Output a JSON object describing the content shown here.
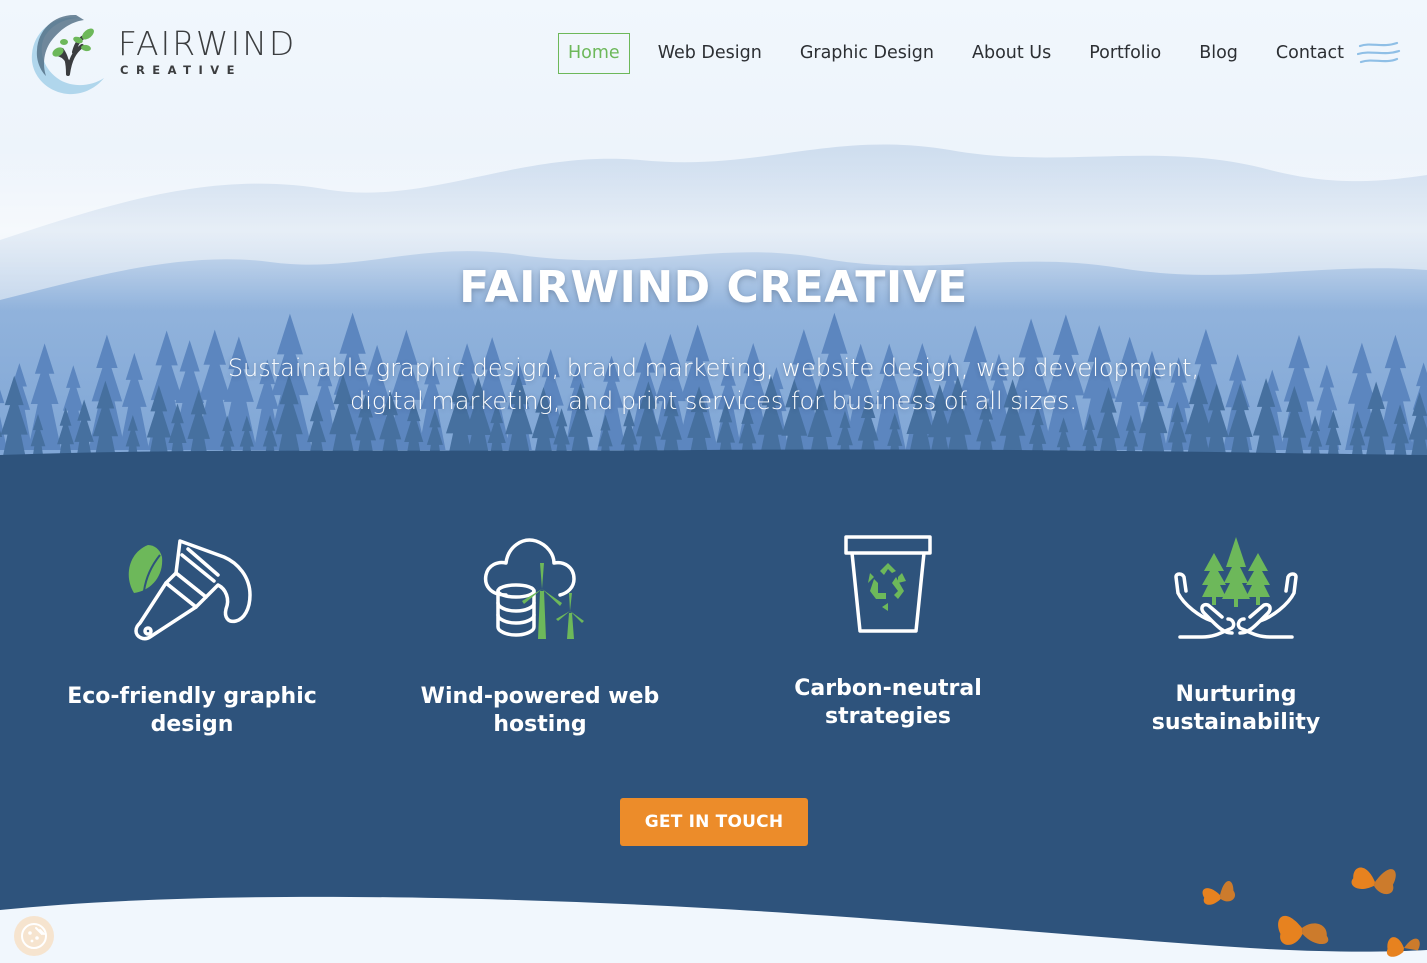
{
  "brand": {
    "name": "FAIRWIND",
    "tagline": "CREATIVE"
  },
  "nav": {
    "items": [
      {
        "label": "Home",
        "active": true
      },
      {
        "label": "Web Design",
        "active": false
      },
      {
        "label": "Graphic Design",
        "active": false
      },
      {
        "label": "About Us",
        "active": false
      },
      {
        "label": "Portfolio",
        "active": false
      },
      {
        "label": "Blog",
        "active": false
      },
      {
        "label": "Contact",
        "active": false
      }
    ],
    "menu_icon": "wind-lines-menu-icon"
  },
  "hero": {
    "title": "FAIRWIND CREATIVE",
    "subtitle": "Sustainable graphic design, brand marketing, website design, web development, digital marketing, and print services for business of all sizes."
  },
  "features": [
    {
      "title": "Eco-friendly graphic design",
      "icon": "leaf-paintbrush-icon"
    },
    {
      "title": "Wind-powered web hosting",
      "icon": "cloud-wind-turbine-icon"
    },
    {
      "title": "Carbon-neutral strategies",
      "icon": "recycle-bin-icon"
    },
    {
      "title": "Nurturing sustainability",
      "icon": "hands-trees-icon"
    }
  ],
  "cta": {
    "label": "GET IN TOUCH"
  },
  "colors": {
    "accent_green": "#6db85a",
    "cta_orange": "#ec8c2a",
    "section_blue": "#2e537c",
    "sky": "#f1f7fd"
  }
}
